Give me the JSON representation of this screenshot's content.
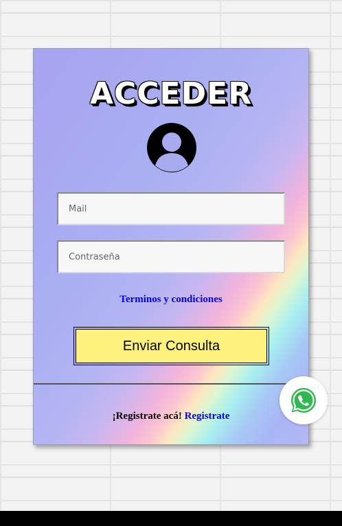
{
  "login": {
    "title": "ACCEDER",
    "mail_placeholder": "Mail",
    "password_placeholder": "Contraseña",
    "terms_link": "Terminos y condiciones",
    "submit_label": "Enviar Consulta",
    "register_prompt": "¡Registrate acá!",
    "register_link": "Registrate"
  },
  "icons": {
    "avatar": "user-avatar-icon",
    "whatsapp": "whatsapp-icon"
  },
  "colors": {
    "submit_bg": "#fff27c",
    "link": "#0000ee",
    "whatsapp_green": "#2fb84f"
  }
}
